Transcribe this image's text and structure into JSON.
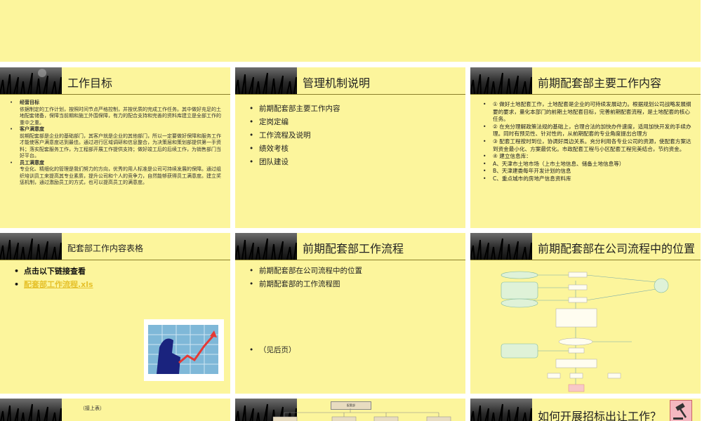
{
  "slides": {
    "s1": {
      "title": "工作目标",
      "sections": [
        {
          "heading": "经营目标",
          "text": "依据制定的工作计划，按照时间节点严格控制，并按优质的完成工作任务。其中做好充足的土地配套储备，保障当前期和施工外围保障，有力的配合支持和完善的资料库建立是全部工作的重中之重。"
        },
        {
          "heading": "客户满意度",
          "text": "前期配套部是企业的基础部门，其客户就是企业的其他部门，所以一定要做好保障和服务工作才能使客户满意度达到最佳。通过进行区域调研和信息整合，为决策层和策划部提供第一手资料；落实配套服务工作，为工程部开展工作提供支持；做好竣工后的后续工作，为销售部门当好平台。"
        },
        {
          "heading": "员工满意度",
          "text": "专业化、精细化的管理是我们努力的方向，优秀的用人标准是公司可持续发展的保障。通过组织培训员工来提高其专业素质，提升公司和个人的竞争力，自然能够获得员工满意度。建立奖惩机制，通过激励员工的方式，也可以提高员工的满意度。"
        }
      ]
    },
    "s2": {
      "title": "管理机制说明",
      "items": [
        "前期配套部主要工作内容",
        "定岗定编",
        "工作流程及说明",
        "绩效考核",
        "团队建设"
      ]
    },
    "s3": {
      "title": "前期配套部主要工作内容",
      "items": [
        "① 做好土地配套工作，土地配套是企业的可持续发展动力。根据规划公司战略发展纲要的要求，量化本部门的前期土地配套目标，完善前期配套流程，是土地配套的核心任务。",
        "② 在充分理解政策法规的基础上，合理合法的加快办件速度，适用加快开发的手续办理。同时有预见性、针对性的，从前期配套的专业角度提出合理方",
        "③ 配套工程按时到位，协调好周边关系。充分利用各专业公司的资源，使配套方案达到资金最小化、方案最优化。市政配套工程与小区配套工程完美结合，节约资金。",
        "④ 建立信息库：",
        "A、天津市土地市场（上市土地信息、储备土地信息等）",
        "B、天津建委每年开发计划的信息",
        "C、重点城市的房地产信息资料库"
      ]
    },
    "s4": {
      "title": "配套部工作内容表格",
      "items": [
        "点击以下链接查看"
      ],
      "link": "配套部工作流程.xls"
    },
    "s5": {
      "title": "前期配套部工作流程",
      "items": [
        "前期配套部在公司流程中的位置",
        "前期配套部的工作流程图"
      ],
      "note": "（见后页）"
    },
    "s6": {
      "title": "前期配套部在公司流程中的位置"
    },
    "s7": {
      "subtitle": "（接上表）"
    },
    "s8": {
      "org_top": "配套部"
    },
    "s9": {
      "title": "如何开展招标出让工作？"
    }
  }
}
